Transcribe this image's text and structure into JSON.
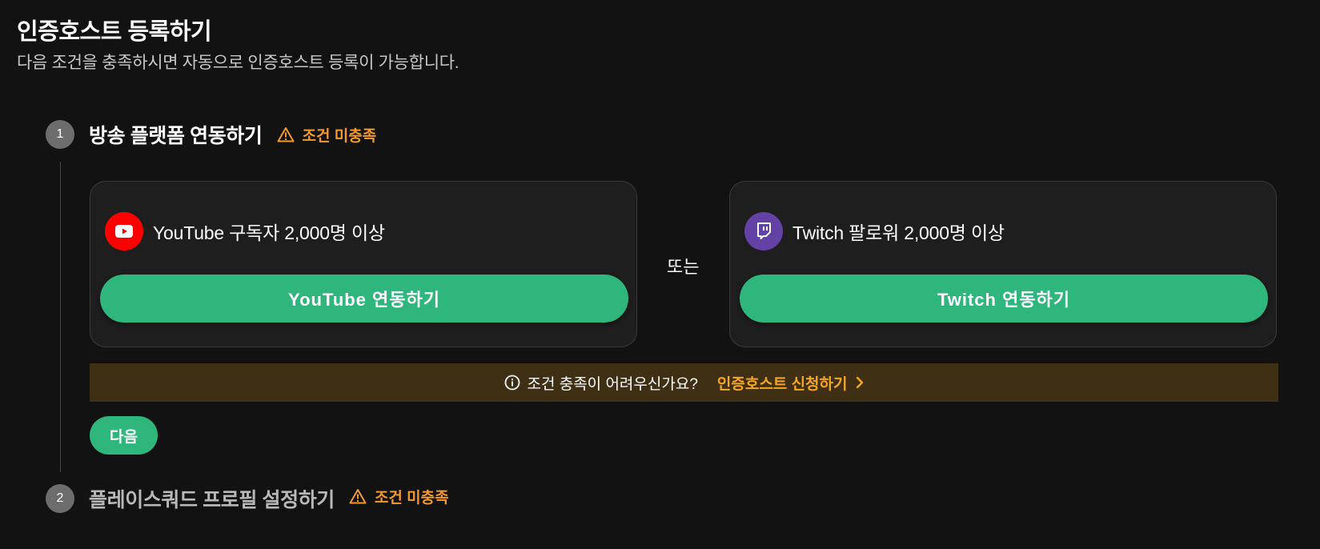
{
  "header": {
    "title": "인증호스트 등록하기",
    "subtitle": "다음 조건을 충족하시면 자동으로 인증호스트 등록이 가능합니다."
  },
  "steps": [
    {
      "number": "1",
      "title": "방송 플랫폼 연동하기",
      "status": "조건 미충족",
      "status_icon": "warning-icon"
    },
    {
      "number": "2",
      "title": "플레이스쿼드 프로필 설정하기",
      "status": "조건 미충족",
      "status_icon": "warning-icon"
    }
  ],
  "platforms": {
    "youtube": {
      "icon": "youtube-icon",
      "label": "YouTube 구독자 2,000명 이상",
      "button": "YouTube 연동하기"
    },
    "twitch": {
      "icon": "twitch-icon",
      "label": "Twitch 팔로워 2,000명 이상",
      "button": "Twitch 연동하기"
    },
    "or_text": "또는"
  },
  "help": {
    "icon": "info-icon",
    "text": "조건 충족이 어려우신가요?",
    "link": "인증호스트 신청하기"
  },
  "next_button": "다음",
  "colors": {
    "accent_green": "#2eb67d",
    "warning_orange": "#f29a2e",
    "youtube_red": "#ff0000",
    "twitch_purple": "#6441a5",
    "banner_bg": "#3f2f14"
  }
}
